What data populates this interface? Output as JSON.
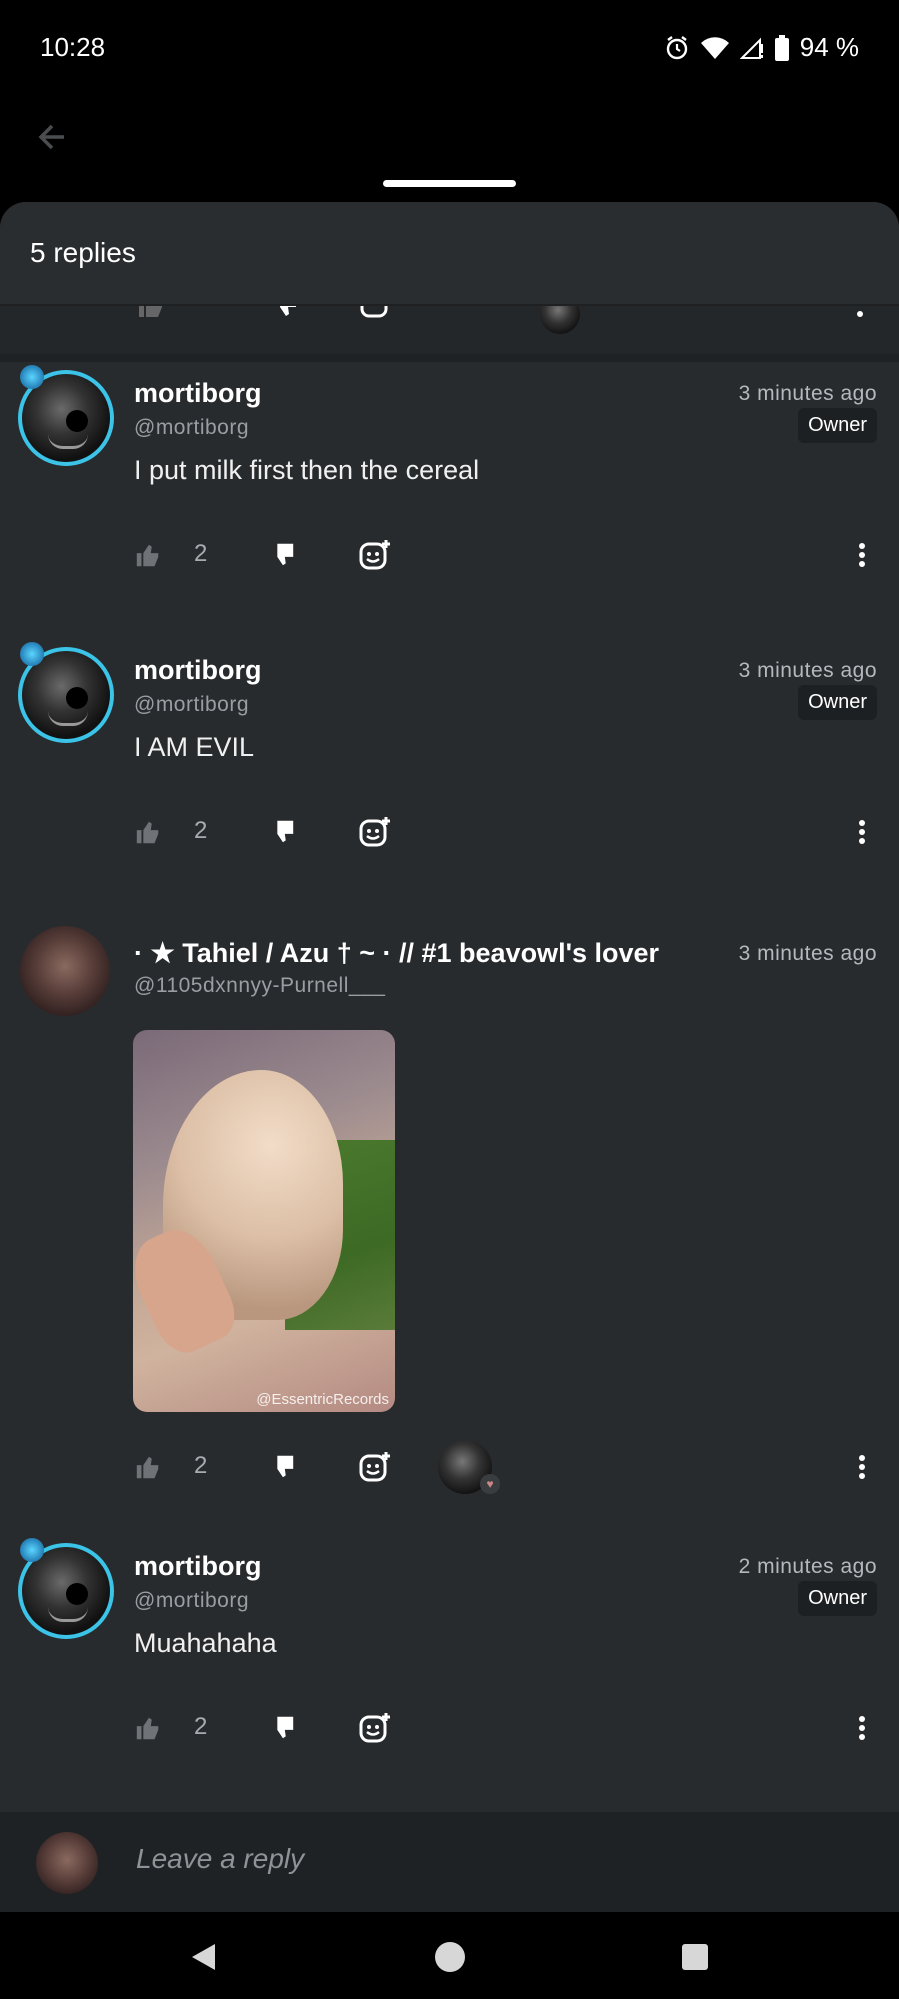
{
  "status_bar": {
    "time": "10:28",
    "battery": "94 %"
  },
  "sheet": {
    "title": "5 replies"
  },
  "comments": [
    {
      "name": "mortiborg",
      "handle": "@mortiborg",
      "time": "3 minutes ago",
      "badge": "Owner",
      "text": "I put milk first then the cereal",
      "likes": "2"
    },
    {
      "name": "mortiborg",
      "handle": "@mortiborg",
      "time": "3 minutes ago",
      "badge": "Owner",
      "text": "I AM EVIL",
      "likes": "2"
    },
    {
      "name": "· ★ Tahiel / Azu † ~ · // #1 beavowl's lover",
      "handle": "@1105dxnnyy-Purnell___",
      "time": "3 minutes ago",
      "media_watermark": "@EssentricRecords",
      "likes": "2"
    },
    {
      "name": "mortiborg",
      "handle": "@mortiborg",
      "time": "2 minutes ago",
      "badge": "Owner",
      "text": "Muahahaha",
      "likes": "2"
    }
  ],
  "reply": {
    "placeholder": "Leave a reply"
  },
  "colors": {
    "sheet_bg": "#282b2d",
    "avatar_ring": "#3cc3e8",
    "secondary_text": "#9a9ea2"
  }
}
